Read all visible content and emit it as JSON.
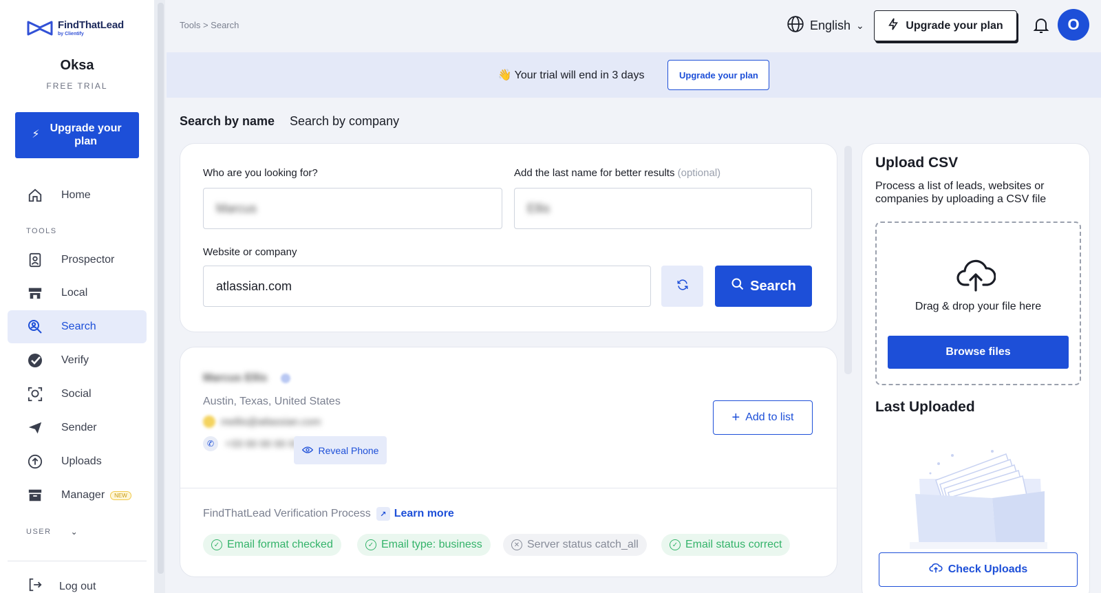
{
  "brand": {
    "name": "FindThatLead",
    "sub": "by Clientify"
  },
  "user": {
    "name": "Oksa",
    "plan": "FREE TRIAL",
    "avatar_initial": "O"
  },
  "sidebar": {
    "upgrade_label": "Upgrade your plan",
    "home_label": "Home",
    "tools_section": "TOOLS",
    "items": [
      {
        "label": "Prospector",
        "icon": "id-badge-icon"
      },
      {
        "label": "Local",
        "icon": "store-icon"
      },
      {
        "label": "Search",
        "icon": "search-person-icon",
        "active": true
      },
      {
        "label": "Verify",
        "icon": "check-badge-icon"
      },
      {
        "label": "Social",
        "icon": "face-scan-icon"
      },
      {
        "label": "Sender",
        "icon": "paper-plane-icon"
      },
      {
        "label": "Uploads",
        "icon": "upload-circle-icon"
      },
      {
        "label": "Manager",
        "icon": "archive-box-icon",
        "badge": "NEW"
      }
    ],
    "user_section": "USER",
    "logout_label": "Log out"
  },
  "topbar": {
    "breadcrumb": "Tools > Search",
    "language": "English",
    "upgrade_label": "Upgrade your plan"
  },
  "banner": {
    "emoji": "👋",
    "text": "Your trial will end in 3 days",
    "button": "Upgrade your plan"
  },
  "tabs": [
    "Search by name",
    "Search by company"
  ],
  "search_form": {
    "first_name_label": "Who are you looking for?",
    "first_name_value": "Marcus",
    "last_name_label": "Add the last name for better results",
    "last_name_optional": "(optional)",
    "last_name_value": "Ellis",
    "company_label": "Website or company",
    "company_value": "atlassian.com",
    "search_button": "Search"
  },
  "result": {
    "name": "Marcus Ellis",
    "location": "Austin, Texas, United States",
    "email": "mellis@atlassian.com",
    "phone": "+33 00 00 00 00",
    "reveal_phone": "Reveal Phone",
    "add_to_list": "Add to list",
    "verification_title": "FindThatLead Verification Process",
    "learn_more": "Learn more",
    "checks": [
      {
        "label": "Email format checked",
        "status": "ok"
      },
      {
        "label": "Email type: business",
        "status": "ok"
      },
      {
        "label": "Server status catch_all",
        "status": "neutral"
      },
      {
        "label": "Email status correct",
        "status": "ok"
      }
    ]
  },
  "upload_panel": {
    "title": "Upload CSV",
    "description": "Process a list of leads, websites or companies by uploading a CSV file",
    "drop_text": "Drag & drop your file here",
    "browse_button": "Browse files",
    "last_uploaded_title": "Last Uploaded",
    "check_button": "Check Uploads"
  },
  "colors": {
    "accent": "#1d4fd8",
    "success": "#34b36a",
    "banner_bg": "#e4e9f8"
  }
}
